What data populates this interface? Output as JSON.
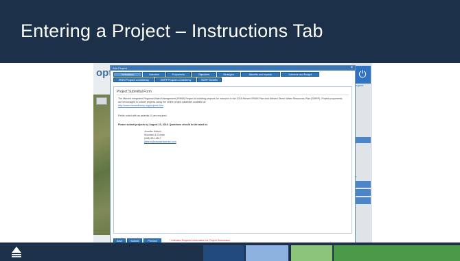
{
  "slide": {
    "title": "Entering a Project – Instructions Tab",
    "colors": {
      "header": "#1c3149",
      "footer_segments": [
        "#234a7c",
        "#8eb2df",
        "#8cc47a",
        "#4a9a48"
      ]
    },
    "footer_logo_icon": "logo-icon"
  },
  "screenshot": {
    "app_logo": "opt",
    "legend_label": "Legend",
    "right_panel_label": "tkz",
    "dialog": {
      "title": "Add Project",
      "close": "×",
      "tabs_row1": [
        "Instructions",
        "Overview",
        "Proponents",
        "Objectives",
        "Strategies",
        "Benefits and Impacts",
        "Schedule and Budget"
      ],
      "tabs_row2": [
        "IRWM Program Consistency",
        "SWRP Program Consistency",
        "SWRP Benefits"
      ],
      "form_title": "Project Submittal Form",
      "paragraph": "The Merced Integrated Regional Water Management (IRWM) Region is soliciting projects for inclusion in the 2018 Merced IRWM Plan and Merced Storm Water Resources Plan (SWRP). Project proponents are encouraged to submit projects using the online project database available at:",
      "url": "http://www.mercedirwmp.org/projects.htm",
      "required_note": "Fields noted with an asterisk (*) are required.",
      "deadline": "Please submit projects by August 23, 2018. Questions should be directed to:",
      "contact": {
        "name": "Jennifer Kidson",
        "company": "Woodard & Curran",
        "phone": "(408) 831-4617",
        "email": "jkidson@woodardcurran.com"
      },
      "buttons": [
        "Save",
        "Submit",
        "Preview"
      ],
      "button_note": "* Indicates Required Information for Project Submission"
    }
  }
}
